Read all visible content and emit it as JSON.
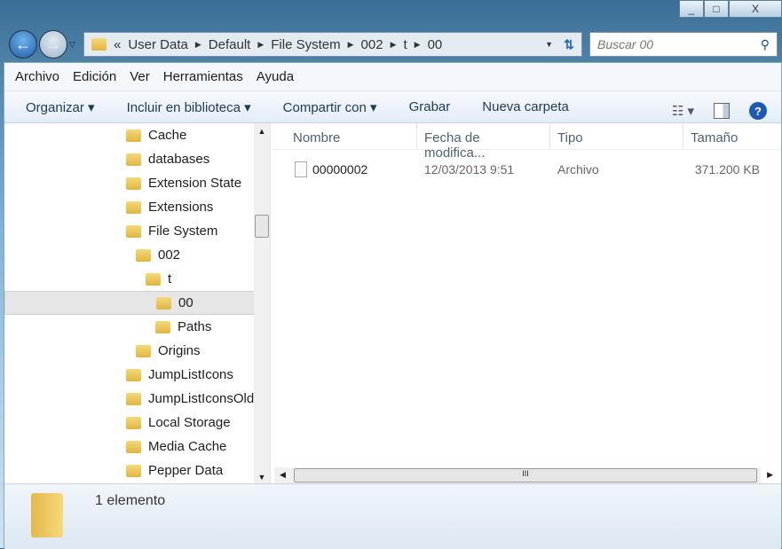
{
  "window": {
    "minimize": "_",
    "maximize": "□",
    "close": "X"
  },
  "nav": {
    "back": "←",
    "forward": "→"
  },
  "address": {
    "overflow": "«",
    "crumbs": [
      "User Data",
      "Default",
      "File System",
      "002",
      "t",
      "00"
    ]
  },
  "search": {
    "placeholder": "Buscar 00",
    "icon": "🔍"
  },
  "menu": [
    "Archivo",
    "Edición",
    "Ver",
    "Herramientas",
    "Ayuda"
  ],
  "toolbar": {
    "organize": "Organizar ▾",
    "include": "Incluir en biblioteca ▾",
    "share": "Compartir con ▾",
    "burn": "Grabar",
    "new_folder": "Nueva carpeta",
    "help": "?"
  },
  "tree": [
    {
      "label": "Cache",
      "indent": 0
    },
    {
      "label": "databases",
      "indent": 0
    },
    {
      "label": "Extension State",
      "indent": 0
    },
    {
      "label": "Extensions",
      "indent": 0
    },
    {
      "label": "File System",
      "indent": 0
    },
    {
      "label": "002",
      "indent": 1
    },
    {
      "label": "t",
      "indent": 2
    },
    {
      "label": "00",
      "indent": 3,
      "selected": true
    },
    {
      "label": "Paths",
      "indent": 3
    },
    {
      "label": "Origins",
      "indent": 1
    },
    {
      "label": "JumpListIcons",
      "indent": 0
    },
    {
      "label": "JumpListIconsOld",
      "indent": 0
    },
    {
      "label": "Local Storage",
      "indent": 0
    },
    {
      "label": "Media Cache",
      "indent": 0
    },
    {
      "label": "Pepper Data",
      "indent": 0
    }
  ],
  "columns": {
    "name": "Nombre",
    "date": "Fecha de modifica...",
    "type": "Tipo",
    "size": "Tamaño"
  },
  "files": [
    {
      "name": "00000002",
      "date": "12/03/2013 9:51",
      "type": "Archivo",
      "size": "371.200 KB"
    }
  ],
  "status": {
    "count": "1 elemento"
  }
}
